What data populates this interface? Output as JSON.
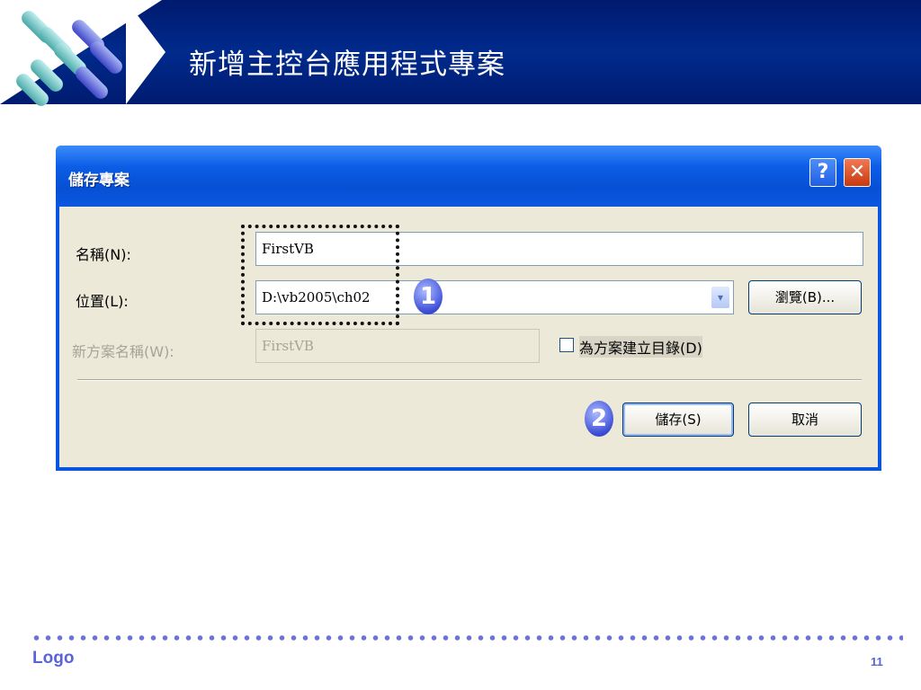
{
  "slide": {
    "title": "新增主控台應用程式專案",
    "footer_logo": "Logo",
    "page_number": "11"
  },
  "dialog": {
    "title": "儲存專案",
    "help_glyph": "?",
    "close_glyph": "✕",
    "name": {
      "label": "名稱(N):",
      "value": "FirstVB"
    },
    "location": {
      "label": "位置(L):",
      "value": "D:\\vb2005\\ch02",
      "arrow_glyph": "▾"
    },
    "solution": {
      "label": "新方案名稱(W):",
      "value": "FirstVB"
    },
    "create_dir_checkbox": {
      "label": "為方案建立目錄(D)",
      "checked": false
    },
    "browse_button": "瀏覽(B)...",
    "save_button": "儲存(S)",
    "cancel_button": "取消"
  },
  "annotations": {
    "step1": "1",
    "step2": "2"
  },
  "icons": {
    "help": "help-icon",
    "close": "close-icon",
    "dropdown": "chevron-down-icon"
  },
  "colors": {
    "header_bg": "#001b70",
    "titlebar_blue": "#0650d4",
    "close_red": "#c9380f",
    "dialog_face": "#ece9d8",
    "step_badge": "#3d4fd8",
    "footer_accent": "#5a64d8"
  }
}
